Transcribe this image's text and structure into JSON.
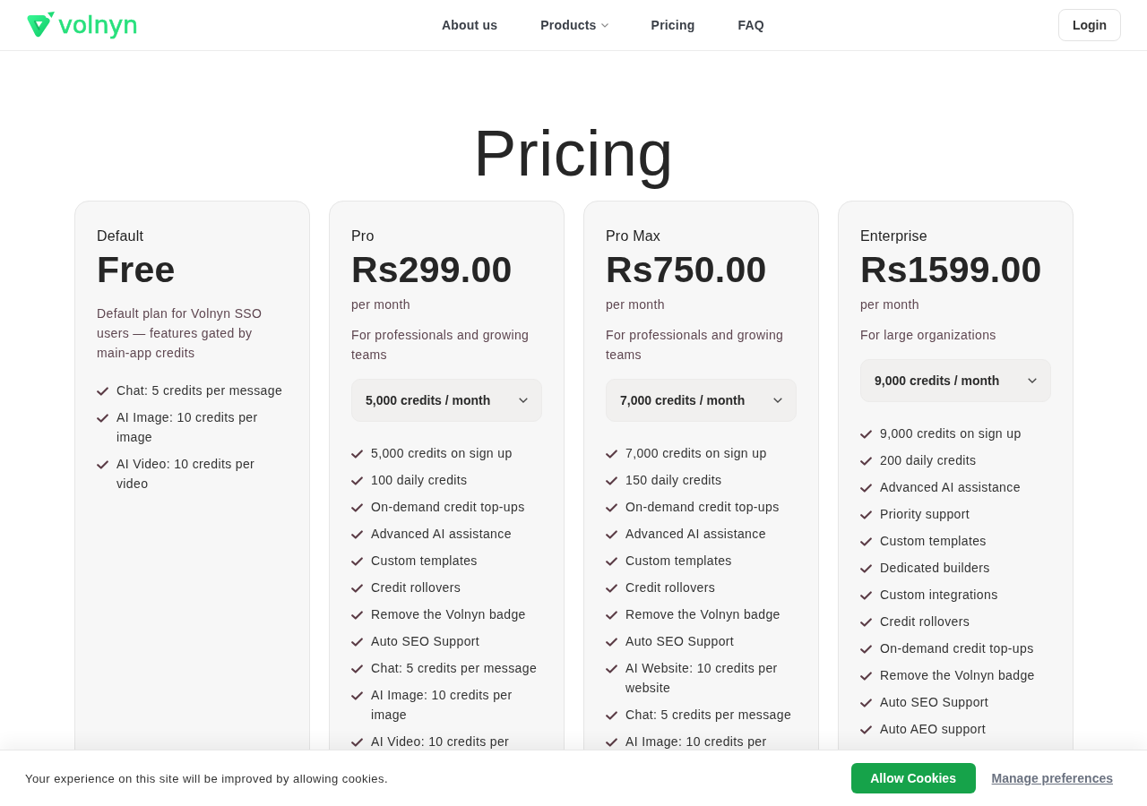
{
  "header": {
    "logo": {
      "text": "volnyn"
    },
    "nav": [
      {
        "label": "About us",
        "dropdown": false
      },
      {
        "label": "Products",
        "dropdown": true
      },
      {
        "label": "Pricing",
        "dropdown": false
      },
      {
        "label": "FAQ",
        "dropdown": false
      }
    ],
    "login_button": "Login"
  },
  "title": "Pricing",
  "plans": [
    {
      "tier": "Default",
      "price": "Free",
      "description": "Default plan for Volnyn SSO users — features gated by main-app credits",
      "features": [
        "Chat: 5 credits per message",
        "AI Image: 10 credits per image",
        "AI Video: 10 credits per video"
      ]
    },
    {
      "tier": "Pro",
      "price": "Rs299.00",
      "period": "per month",
      "description": "For professionals and growing teams",
      "credits_select": "5,000 credits / month",
      "features": [
        "5,000 credits on sign up",
        "100 daily credits",
        "On-demand credit top-ups",
        "Advanced AI assistance",
        "Custom templates",
        "Credit rollovers",
        "Remove the Volnyn badge",
        "Auto SEO Support",
        "Chat: 5 credits per message",
        "AI Image: 10 credits per image",
        "AI Video: 10 credits per"
      ]
    },
    {
      "tier": "Pro Max",
      "price": "Rs750.00",
      "period": "per month",
      "description": "For professionals and growing teams",
      "credits_select": "7,000 credits / month",
      "features": [
        "7,000 credits on sign up",
        "150 daily credits",
        "On-demand credit top-ups",
        "Advanced AI assistance",
        "Custom templates",
        "Credit rollovers",
        "Remove the Volnyn badge",
        "Auto SEO Support",
        "AI Website: 10 credits per website",
        "Chat: 5 credits per message",
        "AI Image: 10 credits per"
      ]
    },
    {
      "tier": "Enterprise",
      "price": "Rs1599.00",
      "period": "per month",
      "description": "For large organizations",
      "credits_select": "9,000 credits / month",
      "features": [
        "9,000 credits on sign up",
        "200 daily credits",
        "Advanced AI assistance",
        "Priority support",
        "Custom templates",
        "Dedicated builders",
        "Custom integrations",
        "Credit rollovers",
        "On-demand credit top-ups",
        "Remove the Volnyn badge",
        "Auto SEO Support",
        "Auto AEO support"
      ]
    }
  ],
  "cookie_banner": {
    "message": "Your experience on this site will be improved by allowing cookies.",
    "accept_button": "Allow Cookies",
    "preferences_link": "Manage preferences"
  }
}
